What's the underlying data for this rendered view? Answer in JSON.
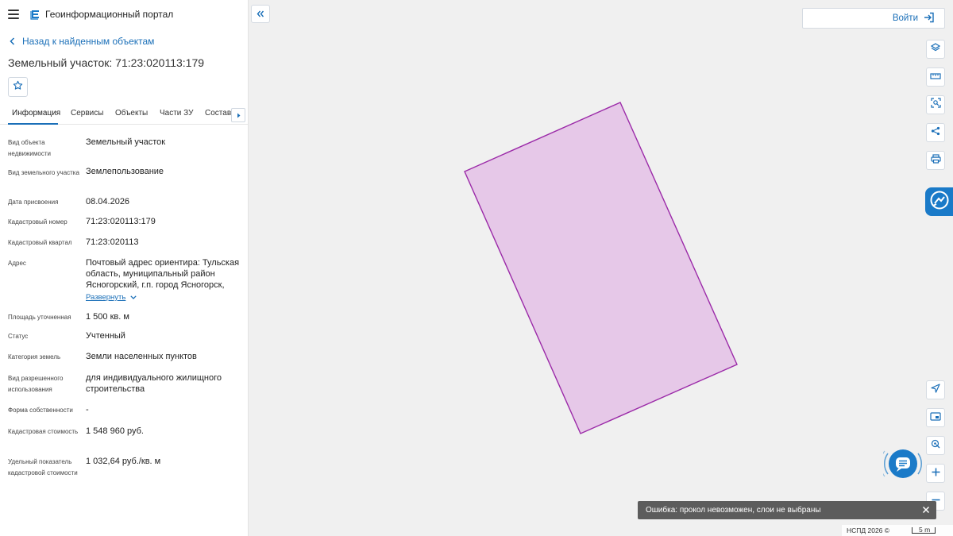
{
  "app": {
    "title": "Геоинформационный портал"
  },
  "nav": {
    "back_label": "Назад к найденным объектам"
  },
  "object": {
    "title": "Земельный участок: 71:23:020113:179"
  },
  "tabs": [
    {
      "label": "Информация",
      "active": true
    },
    {
      "label": "Сервисы",
      "active": false
    },
    {
      "label": "Объекты",
      "active": false
    },
    {
      "label": "Части ЗУ",
      "active": false
    },
    {
      "label": "Состав",
      "active": false
    }
  ],
  "fields": [
    {
      "label": "Вид объекта недвижимости",
      "value": "Земельный участок"
    },
    {
      "label": "Вид земельного участка",
      "value": "Землепользование"
    },
    {
      "label": "Дата присвоения",
      "value": "08.04.2026"
    },
    {
      "label": "Кадастровый номер",
      "value": "71:23:020113:179"
    },
    {
      "label": "Кадастровый квартал",
      "value": "71:23:020113"
    },
    {
      "label": "Адрес",
      "value": "Почтовый адрес ориентира: Тульская область, муниципальный район Ясногорский, г.п. город Ясногорск,"
    },
    {
      "label": "Площадь уточненная",
      "value": "1 500 кв. м"
    },
    {
      "label": "Статус",
      "value": "Учтенный"
    },
    {
      "label": "Категория земель",
      "value": "Земли населенных пунктов"
    },
    {
      "label": "Вид разрешенного использования",
      "value": "для индивидуального жилищного строительства"
    },
    {
      "label": "Форма собственности",
      "value": "-"
    },
    {
      "label": "Кадастровая стоимость",
      "value": "1 548 960 руб."
    },
    {
      "label": "Удельный показатель кадастровой стоимости",
      "value": "1 032,64 руб./кв. м"
    }
  ],
  "address_expand_label": "Развернуть",
  "map": {
    "login_label": "Войти",
    "error_message": "Ошибка: прокол невозможен, слои не выбраны",
    "attribution": "НСПД 2026 ©",
    "scale_label": "5 m",
    "parcel_fill": "#e6c8e8",
    "parcel_stroke": "#9b2aa8"
  },
  "toolbar_icons": [
    "layers-icon",
    "ruler-icon",
    "select-area-icon",
    "share-icon",
    "print-icon",
    "locate-icon",
    "minimap-icon",
    "identify-icon",
    "zoom-in-icon",
    "zoom-out-icon"
  ],
  "colors": {
    "accent": "#1a6fb8",
    "chat_bg": "#1a7ac8",
    "toast_bg": "#5c5c5c"
  }
}
